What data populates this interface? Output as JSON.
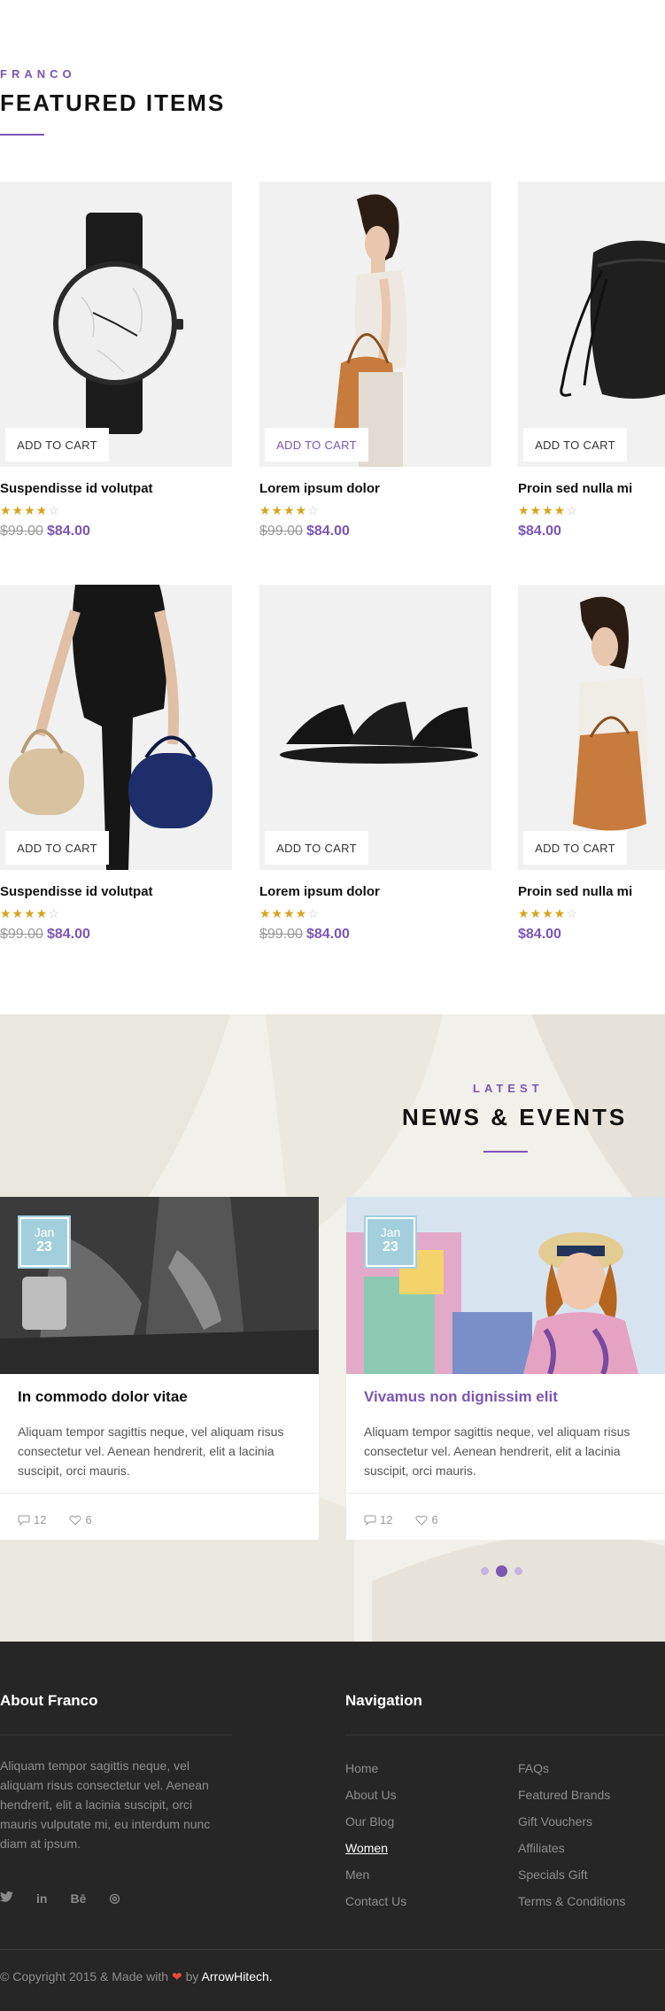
{
  "featured": {
    "eyebrow": "FRANCO",
    "title": "FEATURED ITEMS",
    "add_to_cart": "ADD TO CART",
    "products": [
      {
        "name": "Suspendisse id volutpat",
        "old_price": "$99.00",
        "price": "$84.00",
        "rating": 4,
        "image": "watch"
      },
      {
        "name": "Lorem ipsum dolor",
        "old_price": "$99.00",
        "price": "$84.00",
        "rating": 4,
        "image": "woman-bag"
      },
      {
        "name": "Proin sed nulla mi",
        "old_price": "",
        "price": "$84.00",
        "rating": 4,
        "image": "backpack"
      },
      {
        "name": "Suspendisse id volutpat",
        "old_price": "$99.00",
        "price": "$84.00",
        "rating": 4,
        "image": "man-duffels"
      },
      {
        "name": "Lorem ipsum dolor",
        "old_price": "$99.00",
        "price": "$84.00",
        "rating": 4,
        "image": "sandals"
      },
      {
        "name": "Proin sed nulla mi",
        "old_price": "",
        "price": "$84.00",
        "rating": 4,
        "image": "woman-tote"
      }
    ]
  },
  "news": {
    "eyebrow": "LATEST",
    "title": "NEWS & EVENTS",
    "posts": [
      {
        "month": "Jan",
        "day": "23",
        "title": "In commodo dolor vitae",
        "excerpt": "Aliquam tempor sagittis neque, vel aliquam risus consectetur vel. Aenean hendrerit, elit a lacinia suscipit, orci mauris.",
        "comments": "12",
        "likes": "6"
      },
      {
        "month": "Jan",
        "day": "23",
        "title": "Vivamus non dignissim elit",
        "excerpt": "Aliquam tempor sagittis neque, vel aliquam risus consectetur vel. Aenean hendrerit, elit a lacinia suscipit, orci mauris.",
        "comments": "12",
        "likes": "6"
      }
    ],
    "active_slide": 2,
    "slide_count": 3
  },
  "footer": {
    "about_title": "About Franco",
    "about_text": "Aliquam tempor sagittis neque, vel aliquam risus consectetur vel. Aenean hendrerit, elit a lacinia suscipit, orci mauris vulputate mi, eu interdum nunc diam at ipsum.",
    "social": [
      {
        "icon": "twitter-icon",
        "glyph": "🐦"
      },
      {
        "icon": "linkedin-icon",
        "glyph": "in"
      },
      {
        "icon": "behance-icon",
        "glyph": "Bē"
      },
      {
        "icon": "dribbble-icon",
        "glyph": "◎"
      }
    ],
    "nav_title": "Navigation",
    "nav_col1": [
      "Home",
      "About Us",
      "Our Blog",
      "Women",
      "Men",
      "Contact Us"
    ],
    "nav_col2": [
      "FAQs",
      "Featured Brands",
      "Gift Vouchers",
      "Affiliates",
      "Specials Gift",
      "Terms & Conditions"
    ],
    "nav_current": "Women",
    "copyright_prefix": "© Copyright 2015 & Made with",
    "copyright_by": "by",
    "copyright_brand": "ArrowHitech."
  },
  "colors": {
    "accent": "#7b56b3",
    "star": "#d7a31b",
    "footer_bg": "#262626",
    "date_badge": "#a3cfdc"
  }
}
